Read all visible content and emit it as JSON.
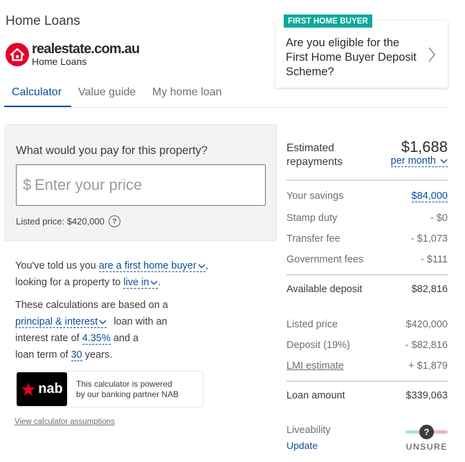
{
  "header": {
    "title": "Home Loans",
    "logo_brand": "realestate.com.au",
    "logo_sub": "Home Loans"
  },
  "tabs": [
    {
      "label": "Calculator",
      "active": true
    },
    {
      "label": "Value guide",
      "active": false
    },
    {
      "label": "My home loan",
      "active": false
    }
  ],
  "promo": {
    "badge": "FIRST HOME BUYER",
    "text": "Are you eligible for the First Home Buyer Deposit Scheme?"
  },
  "price_card": {
    "question": "What would you pay for this property?",
    "currency_symbol": "$",
    "placeholder": "Enter your price",
    "value": "",
    "listed_price": "Listed price: $420,000",
    "help_glyph": "?"
  },
  "context": {
    "line1_prefix": "You've told us you ",
    "buyer_type": "are a first home buyer",
    "line1_suffix": ",",
    "line2_prefix": "looking for a property to ",
    "purpose": "live in",
    "line2_suffix": ".",
    "calc_prefix": "These calculations are based on a",
    "loan_type": "principal & interest",
    "loan_type_suffix": "loan with an",
    "rate_prefix": "interest rate of ",
    "interest_rate": "4.35%",
    "rate_suffix": " and a",
    "term_prefix": "loan term of ",
    "loan_term": "30",
    "term_suffix": " years."
  },
  "partner": {
    "logo_text": "nab",
    "line1": "This calculator is powered",
    "line2": "by our banking partner NAB"
  },
  "assumptions_link": "View calculator assumptions",
  "summary": {
    "estimated_label_1": "Estimated",
    "estimated_label_2": "repayments",
    "repayment_value": "$1,688",
    "frequency": "per month",
    "savings_label": "Your savings",
    "savings_value": "$84,000",
    "stamp_label": "Stamp duty",
    "stamp_value": "- $0",
    "transfer_label": "Transfer fee",
    "transfer_value": "- $1,073",
    "gov_label": "Government fees",
    "gov_value": "- $111",
    "deposit_label": "Available deposit",
    "deposit_value": "$82,816",
    "listed_label": "Listed price",
    "listed_value": "$420,000",
    "deposit_pct_label": "Deposit (19%)",
    "deposit_pct_value": "- $82,816",
    "lmi_label": "LMI estimate",
    "lmi_value": "+ $1,879",
    "loan_label": "Loan amount",
    "loan_value": "$339,063",
    "liveability_label": "Liveability",
    "update_label": "Update",
    "gauge_glyph": "?",
    "liveability_status": "UNSURE"
  },
  "colors": {
    "accent": "#0b4d9c",
    "brand_red": "#e4002b",
    "badge_teal": "#0fa99b"
  }
}
